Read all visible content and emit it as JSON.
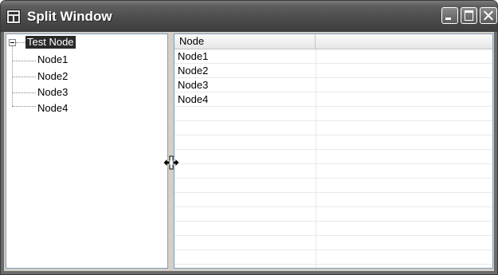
{
  "window": {
    "title": "Split Window"
  },
  "tree": {
    "root": "Test Node",
    "children": [
      "Node1",
      "Node2",
      "Node3",
      "Node4"
    ]
  },
  "list": {
    "columns": [
      "Node",
      ""
    ],
    "rows": [
      "Node1",
      "Node2",
      "Node3",
      "Node4"
    ]
  }
}
